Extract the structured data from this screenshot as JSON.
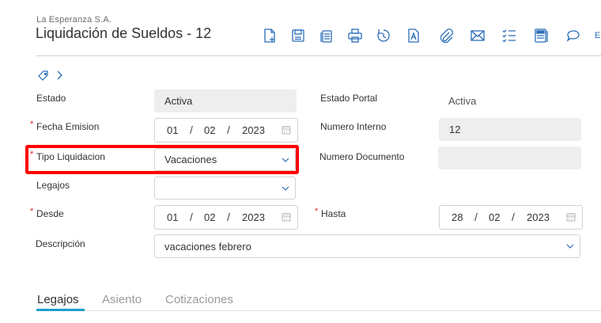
{
  "header": {
    "company": "La Esperanza S.A.",
    "title": "Liquidación de Sueldos - 12",
    "toolbar_overflow_label": "E"
  },
  "toolbar": {
    "icons": [
      "new-document-icon",
      "save-icon",
      "copy-icon",
      "print-icon",
      "history-icon",
      "text-field-icon",
      "attachment-icon",
      "email-icon",
      "checklist-icon",
      "notes-icon",
      "comment-icon"
    ],
    "accent_color": "#2a6db8"
  },
  "form": {
    "estado": {
      "label": "Estado",
      "value": "Activa"
    },
    "estado_portal": {
      "label": "Estado Portal",
      "value": "Activa"
    },
    "fecha_emision": {
      "label": "Fecha Emision",
      "required_mark": "*",
      "day": "01",
      "month": "02",
      "year": "2023"
    },
    "numero_interno": {
      "label": "Numero Interno",
      "value": "12"
    },
    "tipo_liquidacion": {
      "label": "Tipo Liquidacion",
      "required_mark": "*",
      "value": "Vacaciones"
    },
    "numero_documento": {
      "label": "Numero Documento",
      "value": ""
    },
    "legajos": {
      "label": "Legajos",
      "value": ""
    },
    "desde": {
      "label": "Desde",
      "required_mark": "*",
      "day": "01",
      "month": "02",
      "year": "2023"
    },
    "hasta": {
      "label": "Hasta",
      "required_mark": "*",
      "day": "28",
      "month": "02",
      "year": "2023"
    },
    "descripcion": {
      "label": "Descripción",
      "value": "vacaciones febrero"
    },
    "date_separator": "/"
  },
  "tabs": [
    {
      "label": "Legajos",
      "active": true
    },
    {
      "label": "Asiento",
      "active": false
    },
    {
      "label": "Cotizaciones",
      "active": false
    }
  ],
  "highlight_color": "#ff0000",
  "tab_accent_color": "#1aa0c9"
}
